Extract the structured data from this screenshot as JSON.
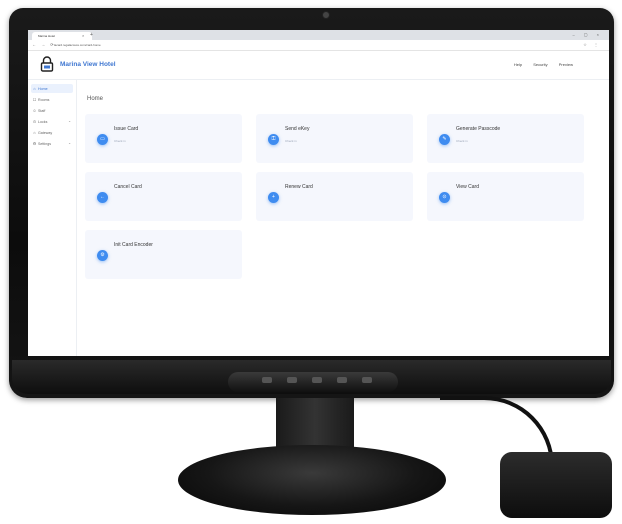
{
  "browser": {
    "tab_title": "Marina Hotel",
    "tab_close": "×",
    "new_tab": "+",
    "window_controls": "–  ▢  ×",
    "nav_buttons": "←  →  ⟳",
    "url": "lacard.regalaccess.com/card-home",
    "addr_icons": "☆  ⋮"
  },
  "header": {
    "title": "Marina View Hotel",
    "nav": [
      "Help",
      "Security",
      "Preview"
    ]
  },
  "sidebar": {
    "items": [
      {
        "label": "Home",
        "icon": "home-icon",
        "glyph": "⌂",
        "active": true
      },
      {
        "label": "Rooms",
        "icon": "rooms-icon",
        "glyph": "☐",
        "active": false
      },
      {
        "label": "Staff",
        "icon": "staff-icon",
        "glyph": "☺",
        "active": false
      },
      {
        "label": "Locks",
        "icon": "lock-icon",
        "glyph": "⊙",
        "active": false,
        "expandable": true
      },
      {
        "label": "Gateway",
        "icon": "gateway-icon",
        "glyph": "⌂",
        "active": false
      },
      {
        "label": "Settings",
        "icon": "gear-icon",
        "glyph": "⚙",
        "active": false,
        "expandable": true
      }
    ],
    "chevron": "⌄"
  },
  "main": {
    "page_title": "Home",
    "cards": [
      {
        "label": "Issue Card",
        "sub": "Check in",
        "icon": "card-icon",
        "glyph": "▭"
      },
      {
        "label": "Send eKey",
        "sub": "Check in",
        "icon": "key-icon",
        "glyph": "⚿"
      },
      {
        "label": "Generate Passcode",
        "sub": "Check in",
        "icon": "passcode-icon",
        "glyph": "✎"
      },
      {
        "label": "Cancel Card",
        "sub": "",
        "icon": "cancel-icon",
        "glyph": "←"
      },
      {
        "label": "Renew Card",
        "sub": "",
        "icon": "renew-icon",
        "glyph": "+"
      },
      {
        "label": "View Card",
        "sub": "",
        "icon": "view-icon",
        "glyph": "⊙"
      },
      {
        "label": "Init Card Encoder",
        "sub": "",
        "icon": "encoder-icon",
        "glyph": "⚙"
      }
    ]
  },
  "colors": {
    "accent": "#3f77d1",
    "card_icon": "#3f8cf0",
    "card_bg": "#f5f7fd"
  }
}
